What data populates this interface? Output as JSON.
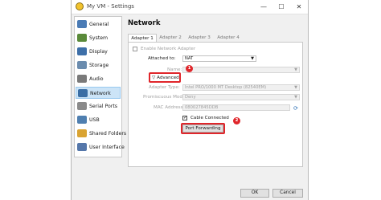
{
  "window": {
    "title": "My VM - Settings",
    "controls": {
      "minimize": "—",
      "maximize": "☐",
      "close": "✕"
    }
  },
  "sidebar": {
    "items": [
      {
        "label": "General",
        "icon": "general-icon",
        "color": "#4a7bb5"
      },
      {
        "label": "System",
        "icon": "system-icon",
        "color": "#5a8a3a"
      },
      {
        "label": "Display",
        "icon": "display-icon",
        "color": "#3d6fa8"
      },
      {
        "label": "Storage",
        "icon": "storage-icon",
        "color": "#6b8cae"
      },
      {
        "label": "Audio",
        "icon": "audio-icon",
        "color": "#7a7a7a"
      },
      {
        "label": "Network",
        "icon": "network-icon",
        "color": "#3a6ea5",
        "selected": true
      },
      {
        "label": "Serial Ports",
        "icon": "serial-ports-icon",
        "color": "#8a8a8a"
      },
      {
        "label": "USB",
        "icon": "usb-icon",
        "color": "#4f7fb0"
      },
      {
        "label": "Shared Folders",
        "icon": "shared-folders-icon",
        "color": "#d9a332"
      },
      {
        "label": "User Interface",
        "icon": "user-interface-icon",
        "color": "#5577aa"
      }
    ]
  },
  "page": {
    "title": "Network"
  },
  "tabs": [
    "Adapter 1",
    "Adapter 2",
    "Adapter 3",
    "Adapter 4"
  ],
  "adapter": {
    "enable_label": "Enable Network Adapter",
    "attached_label": "Attached to:",
    "attached_value": "NAT",
    "name_label": "Name:",
    "advanced_label": "Advanced",
    "adapter_type_label": "Adapter Type:",
    "adapter_type_value": "Intel PRO/1000 MT Desktop (82540EM)",
    "promiscuous_label": "Promiscuous Mode:",
    "promiscuous_value": "Deny",
    "mac_label": "MAC Address:",
    "mac_value": "080027845DDB",
    "cable_label": "Cable Connected",
    "port_forwarding_label": "Port Forwarding"
  },
  "callouts": {
    "one": "1",
    "two": "2"
  },
  "buttons": {
    "ok": "OK",
    "cancel": "Cancel"
  },
  "colors": {
    "callout_red": "#e0262b",
    "selection_blue": "#cce4f7"
  }
}
